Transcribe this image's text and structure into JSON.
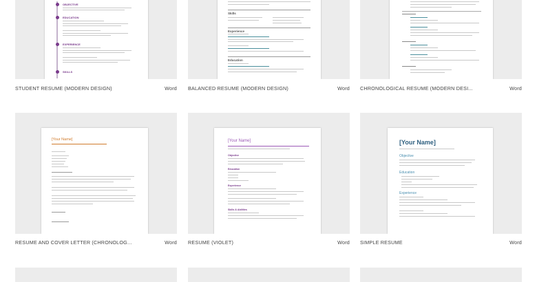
{
  "templates": [
    {
      "name": "STUDENT RESUME (MODERN DESIGN)",
      "app": "Word"
    },
    {
      "name": "BALANCED RESUME (MODERN DESIGN)",
      "app": "Word"
    },
    {
      "name": "CHRONOLOGICAL RESUME (MODERN DESI...",
      "app": "Word"
    },
    {
      "name": "RESUME AND COVER LETTER (CHRONOLOG...",
      "app": "Word"
    },
    {
      "name": "RESUME (VIOLET)",
      "app": "Word"
    },
    {
      "name": "SIMPLE RESUME",
      "app": "Word"
    }
  ],
  "previews": {
    "student": {
      "objective": "OBJECTIVE",
      "education": "EDUCATION",
      "experience": "EXPERIENCE",
      "skills": "SKILLS"
    },
    "balanced": {
      "skills": "Skills",
      "experience": "Experience",
      "education": "Education"
    },
    "cover": {
      "name": "[Your Name]"
    },
    "violet": {
      "name": "[Your Name]",
      "objective": "Objective",
      "education": "Education",
      "experience": "Experience",
      "skills": "Skills & Abilities"
    },
    "simple": {
      "name": "[Your Name]",
      "objective": "Objective",
      "education": "Education",
      "experience": "Experience"
    }
  },
  "colors": {
    "violet_accent": "#7a3b8c",
    "orange_accent": "#d07a2a",
    "blue_accent": "#2e5f7f",
    "teal_accent": "#4a8f9c"
  }
}
